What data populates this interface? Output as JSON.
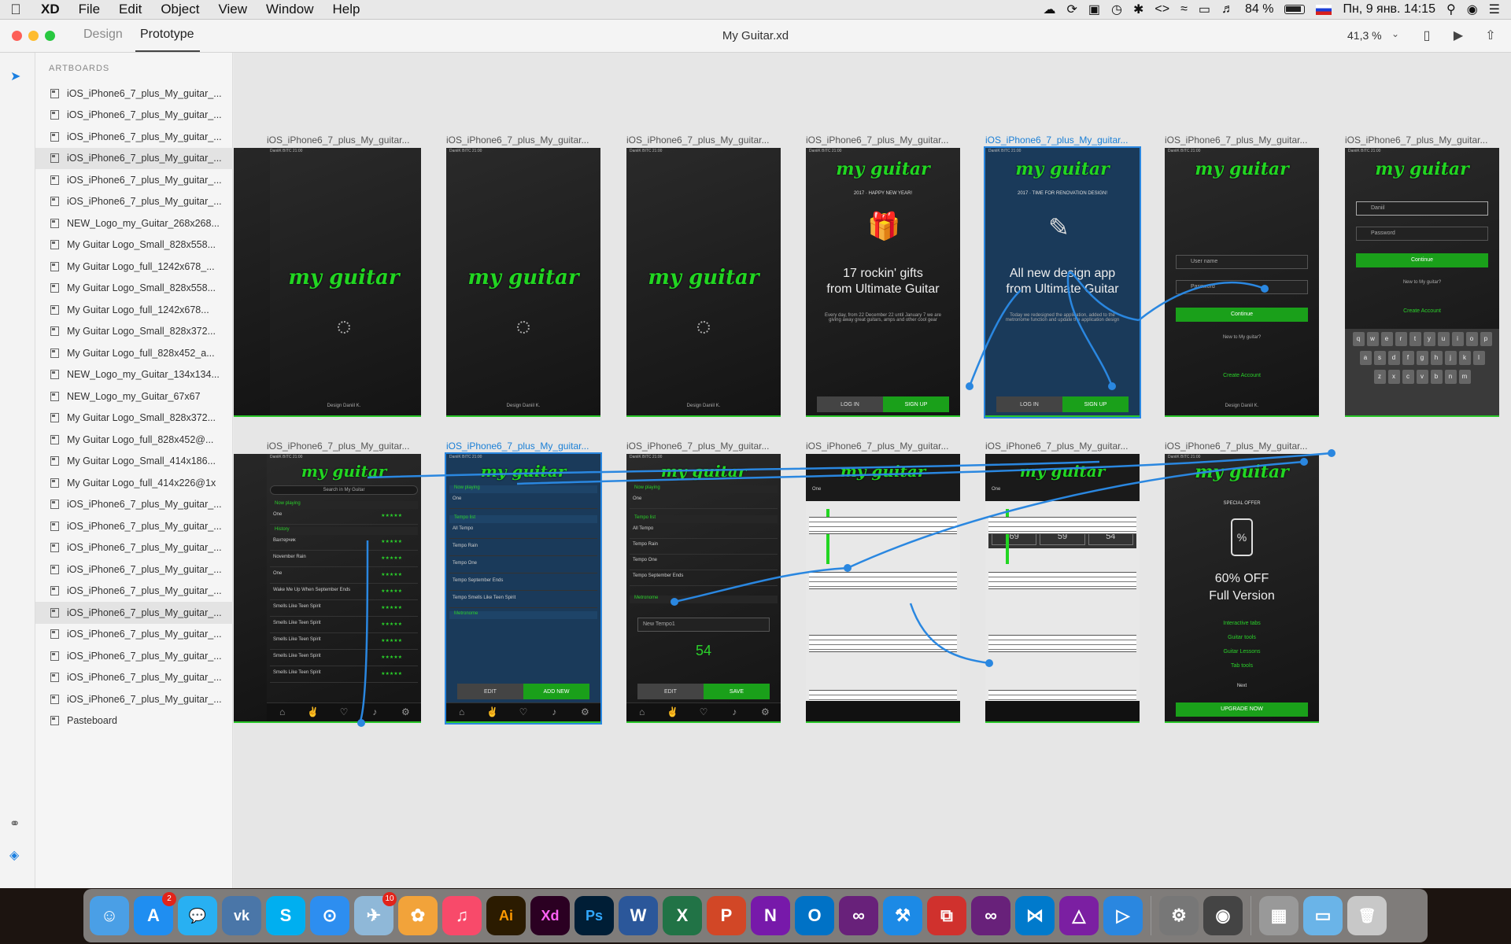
{
  "menubar": {
    "app_name": "XD",
    "menus": [
      "File",
      "Edit",
      "Object",
      "View",
      "Window",
      "Help"
    ],
    "battery": "84 %",
    "datetime": "Пн, 9 янв.  14:15"
  },
  "window": {
    "modes": {
      "design": "Design",
      "prototype": "Prototype"
    },
    "title": "My Guitar.xd",
    "zoom": "41,3 %"
  },
  "sidebar": {
    "heading": "ARTBOARDS",
    "items": [
      "iOS_iPhone6_7_plus_My_guitar_...",
      "iOS_iPhone6_7_plus_My_guitar_...",
      "iOS_iPhone6_7_plus_My_guitar_...",
      "iOS_iPhone6_7_plus_My_guitar_...",
      "iOS_iPhone6_7_plus_My_guitar_...",
      "iOS_iPhone6_7_plus_My_guitar_...",
      "NEW_Logo_my_Guitar_268x268...",
      "My Guitar Logo_Small_828x558...",
      "My Guitar Logo_full_1242x678_...",
      "My Guitar Logo_Small_828x558...",
      "My Guitar Logo_full_1242x678...",
      "My Guitar Logo_Small_828x372...",
      "My Guitar Logo_full_828x452_a...",
      "NEW_Logo_my_Guitar_134x134...",
      "NEW_Logo_my_Guitar_67x67",
      "My Guitar Logo_Small_828x372...",
      "My Guitar Logo_full_828x452@...",
      "My Guitar Logo_Small_414x186...",
      "My Guitar Logo_full_414x226@1x",
      "iOS_iPhone6_7_plus_My_guitar_...",
      "iOS_iPhone6_7_plus_My_guitar_...",
      "iOS_iPhone6_7_plus_My_guitar_...",
      "iOS_iPhone6_7_plus_My_guitar_...",
      "iOS_iPhone6_7_plus_My_guitar_...",
      "iOS_iPhone6_7_plus_My_guitar_...",
      "iOS_iPhone6_7_plus_My_guitar_...",
      "iOS_iPhone6_7_plus_My_guitar_...",
      "iOS_iPhone6_7_plus_My_guitar_...",
      "iOS_iPhone6_7_plus_My_guitar_..."
    ],
    "pasteboard": "Pasteboard"
  },
  "artboards": {
    "title": "iOS_iPhone6_7_plus_My_guitar...",
    "logo": "my guitar",
    "status": "DaniiK BITC  21:00",
    "designer": "Design Daniil K.",
    "gifts": {
      "year": "2017 · HAPPY NEW YEAR!",
      "headline1": "17 rockin' gifts",
      "headline2": "from Ultimate Guitar",
      "body": "Every day, from 22 December 22 until January 7 we are giving away great guitars, amps and other cool gear"
    },
    "newdesign": {
      "year": "2017 · TIME FOR RENOVATION DESIGN!",
      "headline1": "All new design app",
      "headline2": "from Ultimate Guitar",
      "body": "Today we redesigned the application, added to the metronome function and update the application design"
    },
    "login": "LOG IN",
    "signup": "SIGN UP",
    "username": "User name",
    "password": "Password",
    "name_value": "Daniil",
    "continue": "Continue",
    "new_q": "New to My guitar?",
    "create": "Create Account",
    "search": "Search in My Guitar",
    "now_playing": "Now playing",
    "history": "History",
    "songs": [
      "One",
      "Вахтерчик",
      "November Rain",
      "One",
      "Wake Me Up When September Ends",
      "Smells Like Teen Spirit",
      "Smells Like Teen Spirit",
      "Smells Like Teen Spirit",
      "Smells Like Teen Spirit",
      "Smells Like Teen Spirit"
    ],
    "tempo_list": "Tempo list",
    "tempos": [
      "All Tempo",
      "Tempo Rain",
      "Tempo One",
      "Tempo September Ends",
      "Tempo Smells Like Teen Spirit"
    ],
    "metronome": "Metronome",
    "new_tempo": "New Tempo1",
    "bpm": "54",
    "edit": "EDIT",
    "add_new": "ADD NEW",
    "save": "SAVE",
    "tempo_cards": [
      {
        "label": "All Tempo",
        "value": "69"
      },
      {
        "label": "Tempo Rain",
        "value": "59"
      },
      {
        "label": "Tempo One",
        "value": "54"
      }
    ],
    "offer": {
      "special": "SPECIAL OFFER",
      "line1": "60% OFF",
      "line2": "Full Version",
      "items": [
        "Interactive tabs",
        "Guitar tools",
        "Guitar Lessons",
        "Tab tools"
      ],
      "next": "Next",
      "upgrade": "UPGRADE NOW"
    }
  },
  "dock": {
    "appstore_badge": "2",
    "telegram_badge": "10",
    "apps": [
      "Finder",
      "App Store",
      "Messages",
      "VK",
      "Skype",
      "Safari",
      "Telegram",
      "Photos",
      "iTunes",
      "Ai",
      "Xd",
      "Ps",
      "Word",
      "Excel",
      "PowerPoint",
      "OneNote",
      "Outlook",
      "Visual Studio",
      "Xcode",
      "Parallels",
      "VS",
      "VS Code",
      "Affinity",
      "Prototype",
      "System Preferences",
      "Siri",
      "Preview",
      "Folder",
      "Trash"
    ]
  }
}
